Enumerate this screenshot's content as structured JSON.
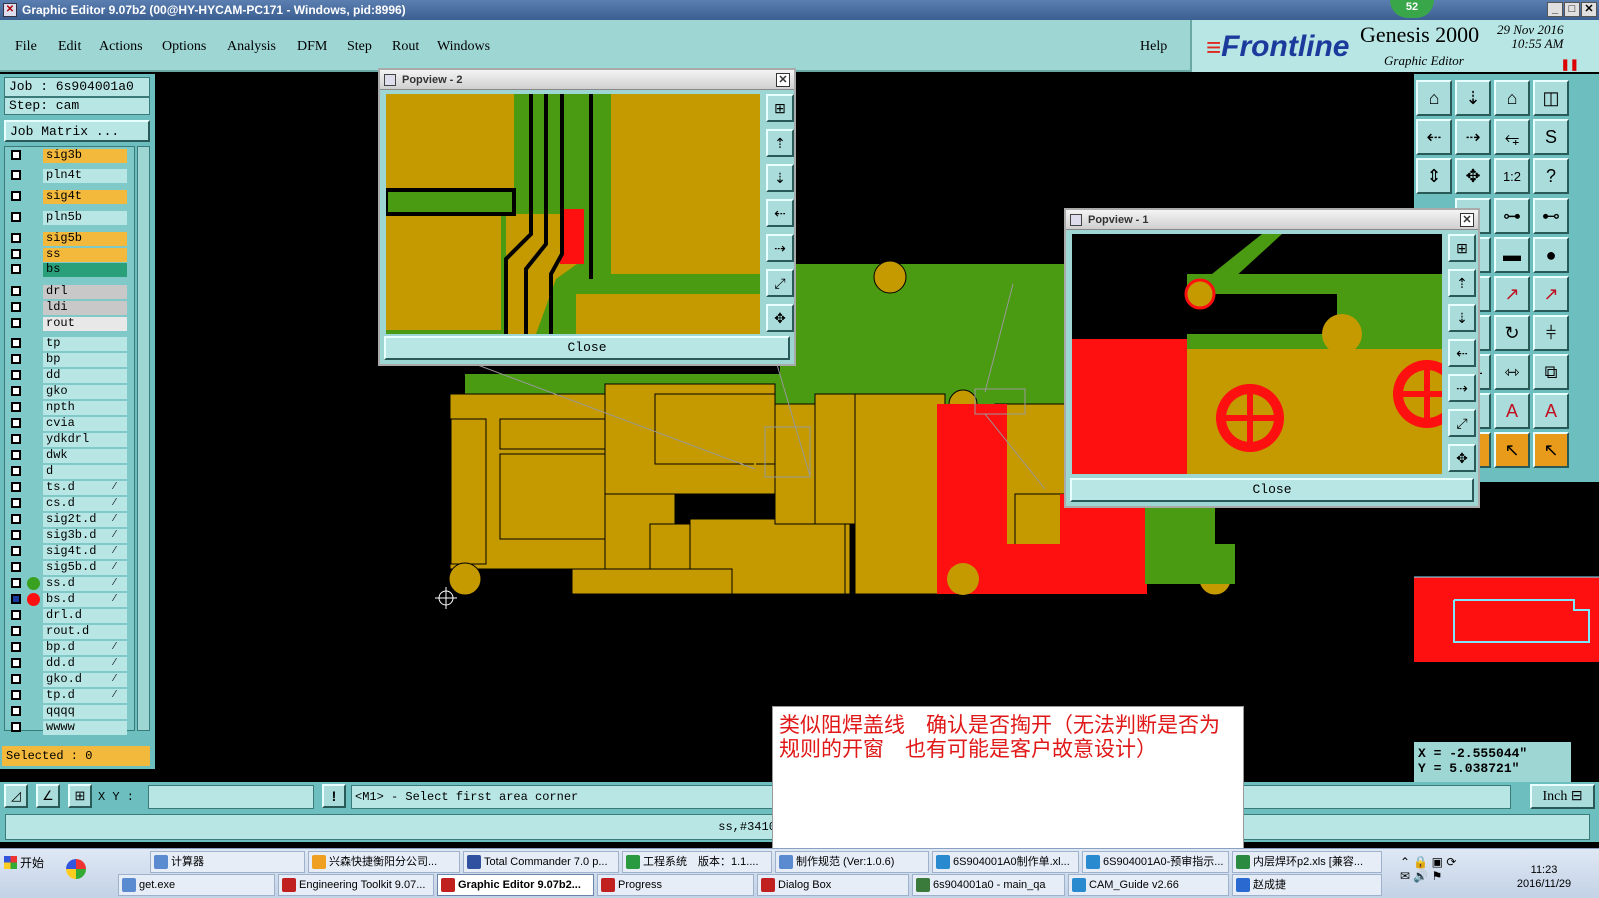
{
  "window": {
    "title": "Graphic Editor 9.07b2 (00@HY-HYCAM-PC171 - Windows, pid:8996)",
    "badge": "52"
  },
  "menu": [
    "File",
    "Edit",
    "Actions",
    "Options",
    "Analysis",
    "DFM",
    "Step",
    "Rout",
    "Windows"
  ],
  "help": "Help",
  "brand": {
    "logo_a": "Front",
    "logo_b": "line",
    "product": "Genesis 2000",
    "subtitle": "Graphic Editor",
    "date": "29 Nov 2016",
    "time": "10:55 AM"
  },
  "job": {
    "job_label": "Job : 6s904001a0",
    "step_label": "Step: cam",
    "matrix_button": "Job Matrix ...",
    "selected": "Selected : 0"
  },
  "layers": [
    {
      "name": "sig3b",
      "color": "#f2b93c"
    },
    {
      "name": "pln4t",
      "color": "#b7e6e4"
    },
    {
      "name": "sig4t",
      "color": "#f2b93c"
    },
    {
      "name": "pln5b",
      "color": "#b7e6e4"
    },
    {
      "name": "sig5b",
      "color": "#f2b93c"
    },
    {
      "name": "ss",
      "color": "#f2b93c"
    },
    {
      "name": "bs",
      "color": "#2aa07a"
    },
    {
      "name": "drl",
      "color": "#c8c8c8"
    },
    {
      "name": "ldi",
      "color": "#c8c8c8"
    },
    {
      "name": "rout",
      "color": "#e8e8e8"
    },
    {
      "name": "tp",
      "color": "#b7e6e4"
    },
    {
      "name": "bp",
      "color": "#b7e6e4"
    },
    {
      "name": "dd",
      "color": "#b7e6e4"
    },
    {
      "name": "gko",
      "color": "#b7e6e4"
    },
    {
      "name": "npth",
      "color": "#b7e6e4"
    },
    {
      "name": "cvia",
      "color": "#b7e6e4"
    },
    {
      "name": "ydkdrl",
      "color": "#b7e6e4"
    },
    {
      "name": "dwk",
      "color": "#b7e6e4"
    },
    {
      "name": "d",
      "color": "#b7e6e4"
    },
    {
      "name": "ts.d",
      "color": "#b7e6e4"
    },
    {
      "name": "cs.d",
      "color": "#b7e6e4"
    },
    {
      "name": "sig2t.d",
      "color": "#b7e6e4"
    },
    {
      "name": "sig3b.d",
      "color": "#b7e6e4"
    },
    {
      "name": "sig4t.d",
      "color": "#b7e6e4"
    },
    {
      "name": "sig5b.d",
      "color": "#b7e6e4"
    },
    {
      "name": "ss.d",
      "color": "#b7e6e4"
    },
    {
      "name": "bs.d",
      "color": "#b7e6e4"
    },
    {
      "name": "drl.d",
      "color": "#b7e6e4"
    },
    {
      "name": "rout.d",
      "color": "#b7e6e4"
    },
    {
      "name": "bp.d",
      "color": "#b7e6e4"
    },
    {
      "name": "dd.d",
      "color": "#b7e6e4"
    },
    {
      "name": "gko.d",
      "color": "#b7e6e4"
    },
    {
      "name": "tp.d",
      "color": "#b7e6e4"
    },
    {
      "name": "qqqq",
      "color": "#b7e6e4"
    },
    {
      "name": "wwww",
      "color": "#b7e6e4"
    }
  ],
  "popview2": {
    "title": "Popview - 2",
    "close": "Close"
  },
  "popview1": {
    "title": "Popview - 1",
    "close": "Close"
  },
  "coords": {
    "x": "X = -2.555044\"",
    "y": "Y = 5.038721\""
  },
  "command": {
    "xy_label": "X Y :",
    "xy_value": "",
    "prompt": "<M1> - Select first area corner",
    "units": "Inch"
  },
  "status": "ss,#3410,Pad(.smd),X=1",
  "note": "类似阻焊盖线　确认是否掏开（无法判断是否为规则的开窗　也有可能是客户故意设计）",
  "taskbar": {
    "start": "开始",
    "row1": [
      "计算器",
      "兴森快捷衡阳分公司...",
      "Total Commander 7.0 p...",
      "工程系统　版本：1.1....",
      "制作规范 (Ver:1.0.6)",
      "6S904001A0制作单.xl...",
      "6S904001A0-预审指示...",
      "内层焊环p2.xls [兼容..."
    ],
    "row2": [
      "get.exe",
      "Engineering Toolkit 9.07...",
      "Graphic Editor 9.07b2...",
      "Progress",
      "Dialog Box",
      "6s904001a0 - main_qa",
      "CAM_Guide v2.66",
      "赵成捷"
    ],
    "time": "11:23",
    "date": "2016/11/29"
  }
}
